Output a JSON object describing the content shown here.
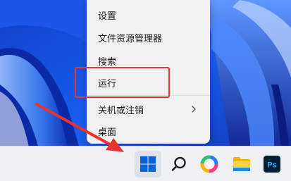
{
  "context_menu": {
    "items": [
      {
        "label": "设置"
      },
      {
        "label": "文件资源管理器"
      },
      {
        "label": "搜索"
      },
      {
        "label": "运行"
      },
      {
        "label": "关机或注销",
        "submenu_icon": "chevron-right-icon"
      },
      {
        "label": "桌面"
      }
    ]
  },
  "annotation": {
    "color": "#e03a3a",
    "highlighted_item": "运行"
  },
  "taskbar": {
    "buttons": [
      {
        "icon": "windows-start-icon"
      },
      {
        "icon": "search-icon"
      },
      {
        "icon": "color-app-icon"
      },
      {
        "icon": "file-explorer-icon"
      },
      {
        "icon": "photoshop-icon",
        "label": "Ps"
      }
    ]
  },
  "colors": {
    "wallpaper_deep": "#0b1c8a",
    "wallpaper_light": "#7fb0ff",
    "accent": "#0a64d8",
    "ps_bg": "#001e36",
    "ps_text": "#31a8ff"
  }
}
